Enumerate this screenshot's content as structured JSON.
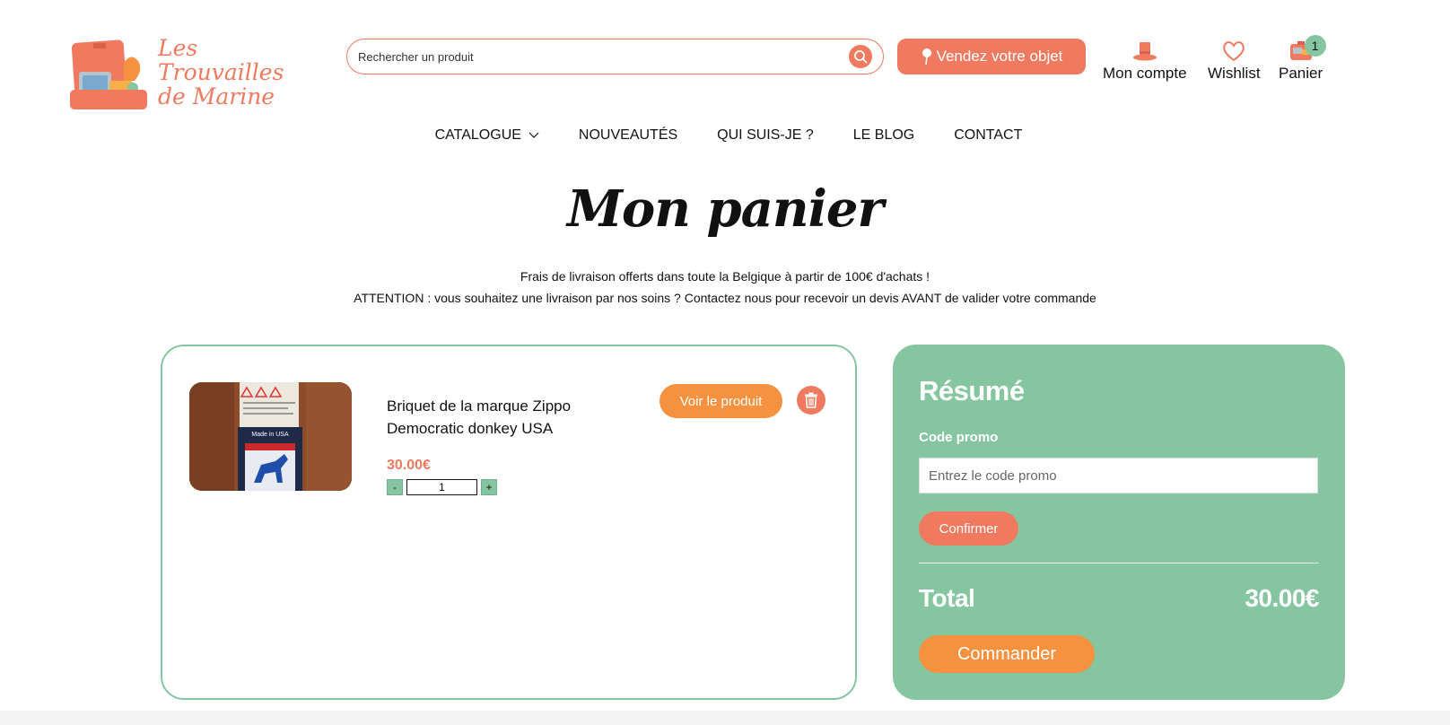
{
  "header": {
    "logo_line1": "Les Trouvailles",
    "logo_line2": "de Marine",
    "search_placeholder": "Rechercher un produit",
    "sell_label": "Vendez votre objet",
    "account_label": "Mon compte",
    "wishlist_label": "Wishlist",
    "cart_label": "Panier",
    "cart_count": "1"
  },
  "nav": {
    "items": [
      "CATALOGUE",
      "NOUVEAUTÉS",
      "QUI SUIS-JE ?",
      "LE BLOG",
      "CONTACT"
    ]
  },
  "page": {
    "title": "Mon panier",
    "notice1": "Frais de livraison offerts dans toute la Belgique à partir de 100€ d'achats !",
    "notice2": "ATTENTION : vous souhaitez une livraison par nos soins ? Contactez nous pour recevoir un devis AVANT de valider votre commande"
  },
  "cart": {
    "item": {
      "name": "Briquet de la marque Zippo Democratic donkey USA",
      "price": "30.00€",
      "quantity": "1",
      "minus": "-",
      "plus": "+",
      "view_label": "Voir le produit",
      "image_text": "Made in USA"
    }
  },
  "summary": {
    "title": "Résumé",
    "promo_label": "Code promo",
    "promo_placeholder": "Entrez le code promo",
    "confirm_label": "Confirmer",
    "total_label": "Total",
    "total_value": "30.00€",
    "order_label": "Commander"
  },
  "colors": {
    "coral": "#f07a5f",
    "orange": "#f5913f",
    "green": "#85c6a0"
  }
}
